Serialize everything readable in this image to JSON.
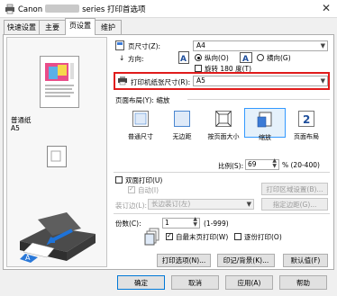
{
  "window": {
    "title_prefix": "Canon",
    "title_suffix": "series 打印首选项",
    "close_glyph": "✕"
  },
  "tabs": [
    {
      "label": "快速设置"
    },
    {
      "label": "主要"
    },
    {
      "label": "页设置"
    },
    {
      "label": "维护"
    }
  ],
  "preview": {
    "paper_type": "普通纸",
    "paper_size": "A5"
  },
  "page_settings": {
    "page_size_label": "页尺寸(Z):",
    "page_size_value": "A4",
    "orientation_label": "方向:",
    "portrait_label": "纵向(O)",
    "landscape_label": "横向(G)",
    "rotate_label": "旋转 180 度(T)",
    "printer_paper_label": "打印机纸张尺寸(R):",
    "printer_paper_value": "A5"
  },
  "layout": {
    "label": "页面布局(Y): 缩放",
    "options": [
      {
        "label": "普通尺寸"
      },
      {
        "label": "无边距"
      },
      {
        "label": "按页面大小"
      },
      {
        "label": "缩放"
      },
      {
        "label": "页面布局"
      }
    ],
    "scale_label": "比例(S):",
    "scale_value": "69",
    "scale_range": "% (20-400)"
  },
  "duplex": {
    "duplex_label": "双面打印(U)",
    "auto_label": "自动(I)",
    "print_area_button": "打印区域设置(B)...",
    "staple_label": "装订边(L):",
    "staple_value": "长边装订(左)",
    "margin_button": "指定边距(G)..."
  },
  "copies": {
    "label": "份数(C):",
    "value": "1",
    "range": "(1-999)",
    "reverse_label": "自最末页打印(W)",
    "collate_label": "逐份打印(O)"
  },
  "bottom_buttons": {
    "print_options": "打印选项(N)...",
    "stamp": "印记/背景(K)...",
    "defaults": "默认值(F)"
  },
  "dialog_buttons": {
    "ok": "确定",
    "cancel": "取消",
    "apply": "应用(A)",
    "help": "帮助"
  }
}
